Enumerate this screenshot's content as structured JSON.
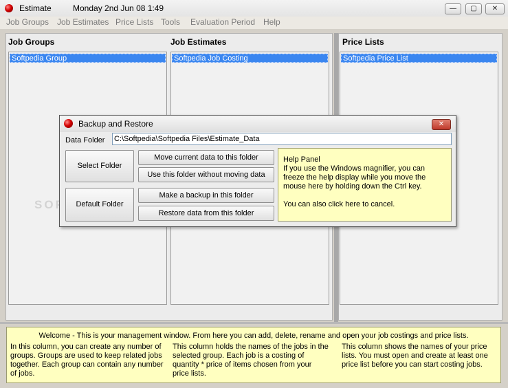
{
  "window": {
    "title": "Estimate",
    "date_time": "Monday  2nd Jun 08  1:49",
    "controls": {
      "minimize": "—",
      "maximize": "▢",
      "close": "✕"
    }
  },
  "menu": [
    "Job Groups",
    "Job Estimates",
    "Price Lists",
    "Tools",
    "Evaluation Period",
    "Help"
  ],
  "columns": {
    "job_groups": {
      "title": "Job Groups",
      "items": [
        "Softpedia Group"
      ]
    },
    "job_estimates": {
      "title": "Job Estimates",
      "items": [
        "Softpedia Job Costing"
      ]
    },
    "price_lists": {
      "title": "Price Lists",
      "items": [
        "Softpedia Price List"
      ]
    }
  },
  "dialog": {
    "title": "Backup and Restore",
    "data_folder_label": "Data Folder",
    "data_folder_value": "C:\\Softpedia\\Softpedia Files\\Estimate_Data",
    "buttons": {
      "select_folder": "Select Folder",
      "default_folder": "Default Folder",
      "move_data": "Move current data to this folder",
      "use_folder": "Use this folder without moving data",
      "make_backup": "Make a backup in this folder",
      "restore": "Restore data from this folder"
    },
    "help_panel": {
      "title": "Help Panel",
      "text": "If you use the Windows magnifier, you can freeze the help display while you move the mouse here by holding down the Ctrl key.",
      "cancel": "You can also click here to cancel."
    }
  },
  "welcome": {
    "headline": "Welcome - This is your management window. From here you can add, delete, rename and open your job costings and price lists.",
    "col1": "In this column, you can create any number of groups. Groups are used to keep related jobs together. Each group can contain any number of jobs.",
    "col2": "This column holds the names of the jobs in the selected group. Each job is a costing of quantity * price of items chosen from your price lists.",
    "col3": "This column shows the names of your price lists. You must open and create at least one price list before you can start costing jobs."
  },
  "watermark": "SOFTPEDIA",
  "colors": {
    "selection": "#3a86f0",
    "help_bg": "#ffffc0",
    "close_button": "#c0392b"
  }
}
